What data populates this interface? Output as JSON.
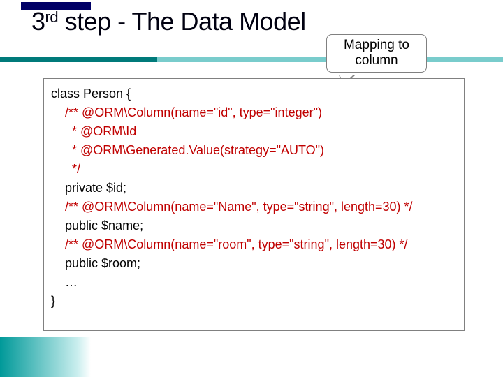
{
  "title_prefix": "3",
  "title_super": "rd",
  "title_rest": " step - The Data Model",
  "callout_line1": "Mapping to",
  "callout_line2": "column",
  "code": {
    "l1": "class Person {",
    "l2": "    /** @ORM\\Column(name=\"id\", type=\"integer\")",
    "l3": "      * @ORM\\Id",
    "l4": "      * @ORM\\Generated.Value(strategy=\"AUTO\")",
    "l5": "      */",
    "l6": "    private $id;",
    "l7": "    /** @ORM\\Column(name=\"Name\", type=\"string\", length=30) */",
    "l8": "    public $name;",
    "l9": "    /** @ORM\\Column(name=\"room\", type=\"string\", length=30) */",
    "l10": "    public $room;",
    "l11": "    …",
    "l12": "}"
  }
}
